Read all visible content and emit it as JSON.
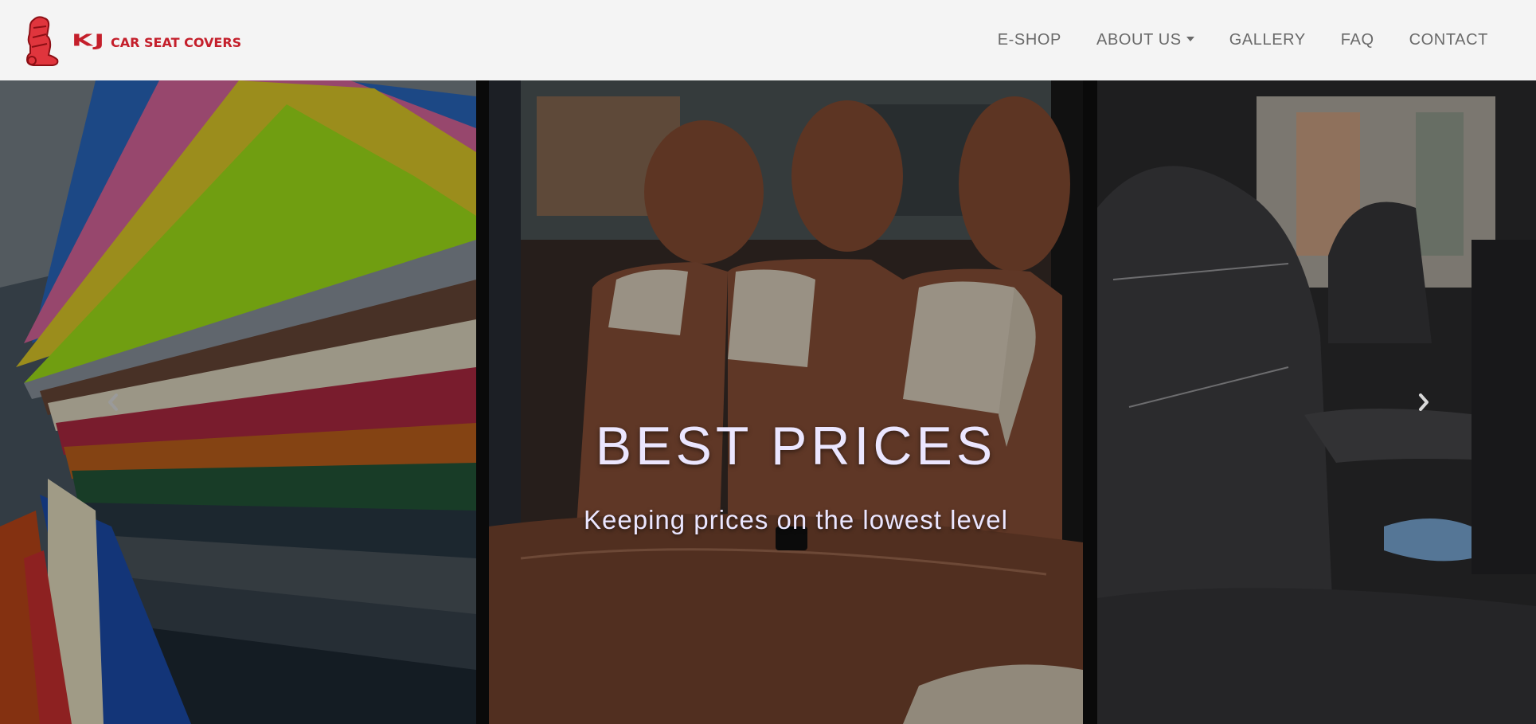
{
  "brand": {
    "name": "KJ",
    "tagline": "CAR SEAT COVERS",
    "logo_icon": "car-seat-icon",
    "color": "#c41f2b"
  },
  "nav": {
    "items": [
      {
        "label": "E-SHOP"
      },
      {
        "label": "ABOUT US",
        "has_dropdown": true
      },
      {
        "label": "GALLERY"
      },
      {
        "label": "FAQ"
      },
      {
        "label": "CONTACT"
      }
    ]
  },
  "carousel": {
    "caption_title": "BEST PRICES",
    "caption_subtitle": "Keeping prices on the lowest level",
    "prev_icon": "chevron-left-icon",
    "next_icon": "chevron-right-icon",
    "slides": [
      {
        "image": "leather-swatches-image"
      },
      {
        "image": "brown-rear-seat-image"
      },
      {
        "image": "black-front-seat-image"
      }
    ]
  }
}
